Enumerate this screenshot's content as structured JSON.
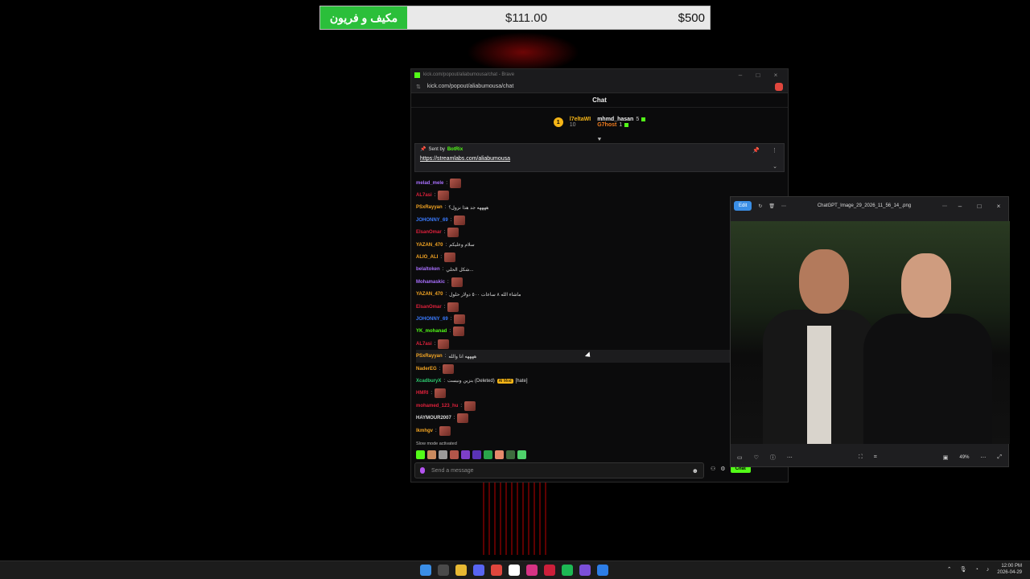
{
  "donation_bar": {
    "label": "مكيف و فريون",
    "current": "$111.00",
    "goal": "$500"
  },
  "browser": {
    "title": "kick.com/popout/aliabumousa/chat - Brave",
    "url": "kick.com/popout/aliabumousa/chat",
    "chat_header": "Chat"
  },
  "leaderboard": {
    "rank": "1",
    "first_user": "l7eltaWI",
    "first_value": "10",
    "users": [
      {
        "name": "mhmd_hasan",
        "count": "5"
      },
      {
        "name": "G7host",
        "count": "1"
      }
    ]
  },
  "pinned": {
    "sent_by": "Sent by",
    "bot": "BotRix",
    "link": "https://streamlabs.com/aliabumousa"
  },
  "messages": [
    {
      "user": "melad_mele",
      "color": "#a970ff",
      "text": ""
    },
    {
      "user": "AL7asi",
      "color": "#e0213c",
      "text": ""
    },
    {
      "user": "PSxRayyan",
      "color": "#f5a623",
      "text": "ههههه جد هذا نزول؟"
    },
    {
      "user": "JOHONNY_69",
      "color": "#3a7bff",
      "text": ""
    },
    {
      "user": "ElsanOmar",
      "color": "#e0213c",
      "text": ""
    },
    {
      "user": "YAZAN_470",
      "color": "#f5a623",
      "text": "سلام وعليكم"
    },
    {
      "user": "ALIO_ALI",
      "color": "#f5a623",
      "text": ""
    },
    {
      "user": "belaltoken",
      "color": "#a970ff",
      "text": "شكل الحلي..."
    },
    {
      "user": "Mohamaskic",
      "color": "#a970ff",
      "text": ""
    },
    {
      "user": "YAZAN_470",
      "color": "#f5a623",
      "text": "ماشاء الله ٨ ساعات ٥٠٠ دولار حلول"
    },
    {
      "user": "ElsanOmar",
      "color": "#e0213c",
      "text": ""
    },
    {
      "user": "JOHONNY_69",
      "color": "#3a7bff",
      "text": ""
    },
    {
      "user": "YK_mohanad",
      "color": "#53fc18",
      "text": ""
    },
    {
      "user": "AL7asi",
      "color": "#e0213c",
      "text": ""
    },
    {
      "user": "PSxRayyan",
      "color": "#f5a623",
      "text": "ههههه انا والله"
    },
    {
      "user": "NaderEG",
      "color": "#f5a623",
      "text": ""
    },
    {
      "user": "XcadburyX",
      "color": "#2ecc71",
      "text": "بنزين ونيست (Deleted)"
    },
    {
      "user": "HMRI",
      "color": "#e0213c",
      "text": ""
    },
    {
      "user": "mohamed_123_hu",
      "color": "#e0213c",
      "text": ""
    },
    {
      "user": "HAYMOUR2007",
      "color": "#dddddd",
      "text": ""
    },
    {
      "user": "lkmhgv",
      "color": "#f5a623",
      "text": ""
    }
  ],
  "ai_mod_tag": "AI Mod",
  "hate_tag": "[hate]",
  "slow_mode": "Slow mode activated",
  "input": {
    "placeholder": "Send a message",
    "send_label": "Chat"
  },
  "viewer": {
    "edit_label": "Edit",
    "filename": "ChatGPT_Image_29_2026_11_56_14_.png",
    "zoom": "49%"
  },
  "clock": {
    "time": "12:00 PM",
    "date": "2026-04-29"
  }
}
